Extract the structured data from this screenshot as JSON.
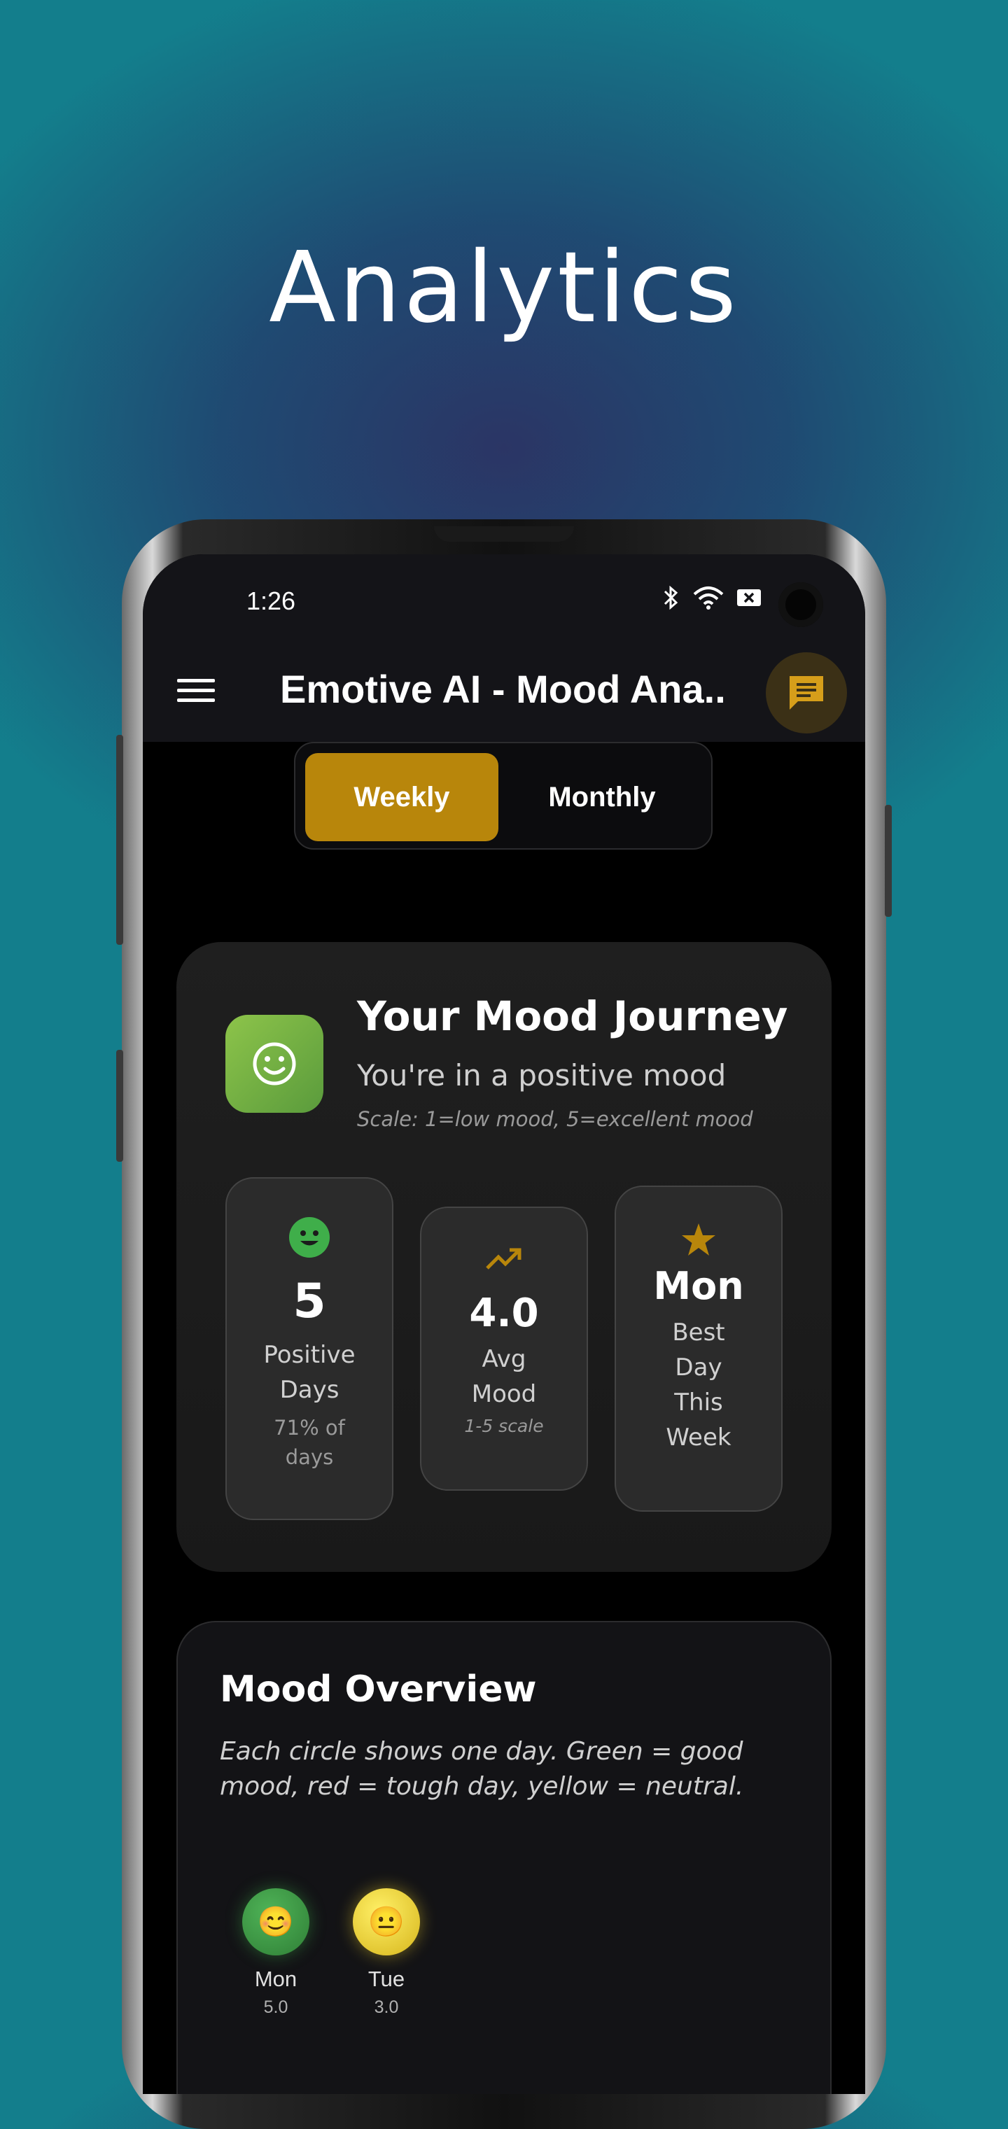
{
  "hero": {
    "title": "Analytics"
  },
  "status_bar": {
    "time": "1:26"
  },
  "app_bar": {
    "title": "Emotive AI - Mood Ana..."
  },
  "toggle": {
    "weekly": "Weekly",
    "monthly": "Monthly",
    "selected": "Weekly"
  },
  "journey": {
    "title": "Your Mood Journey",
    "subtitle": "You're in a positive mood",
    "scale": "Scale: 1=low mood, 5=excellent mood",
    "stats": [
      {
        "value": "5",
        "label_line1": "Positive",
        "label_line2": "Days",
        "note_line1": "71% of",
        "note_line2": "days",
        "icon": "smiley-icon"
      },
      {
        "value": "4.0",
        "label_line1": "Avg",
        "label_line2": "Mood",
        "note": "1-5 scale",
        "icon": "trending-up-icon"
      },
      {
        "value": "Mon",
        "label_line1": "Best",
        "label_line2": "Day",
        "label_line3": "This",
        "label_line4": "Week",
        "icon": "star-icon"
      }
    ]
  },
  "overview": {
    "title": "Mood Overview",
    "description": "Each circle shows one day. Green = good mood, red = tough day, yellow = neutral.",
    "days": [
      {
        "name": "Mon",
        "value": "5.0",
        "emoji": "😊",
        "color": "#3f9a46"
      },
      {
        "name": "Tue",
        "value": "3.0",
        "emoji": "😐",
        "color": "#f2d22a"
      }
    ]
  },
  "colors": {
    "accent": "#b8860b",
    "positive": "#3fae4a",
    "neutral": "#f2d22a"
  }
}
